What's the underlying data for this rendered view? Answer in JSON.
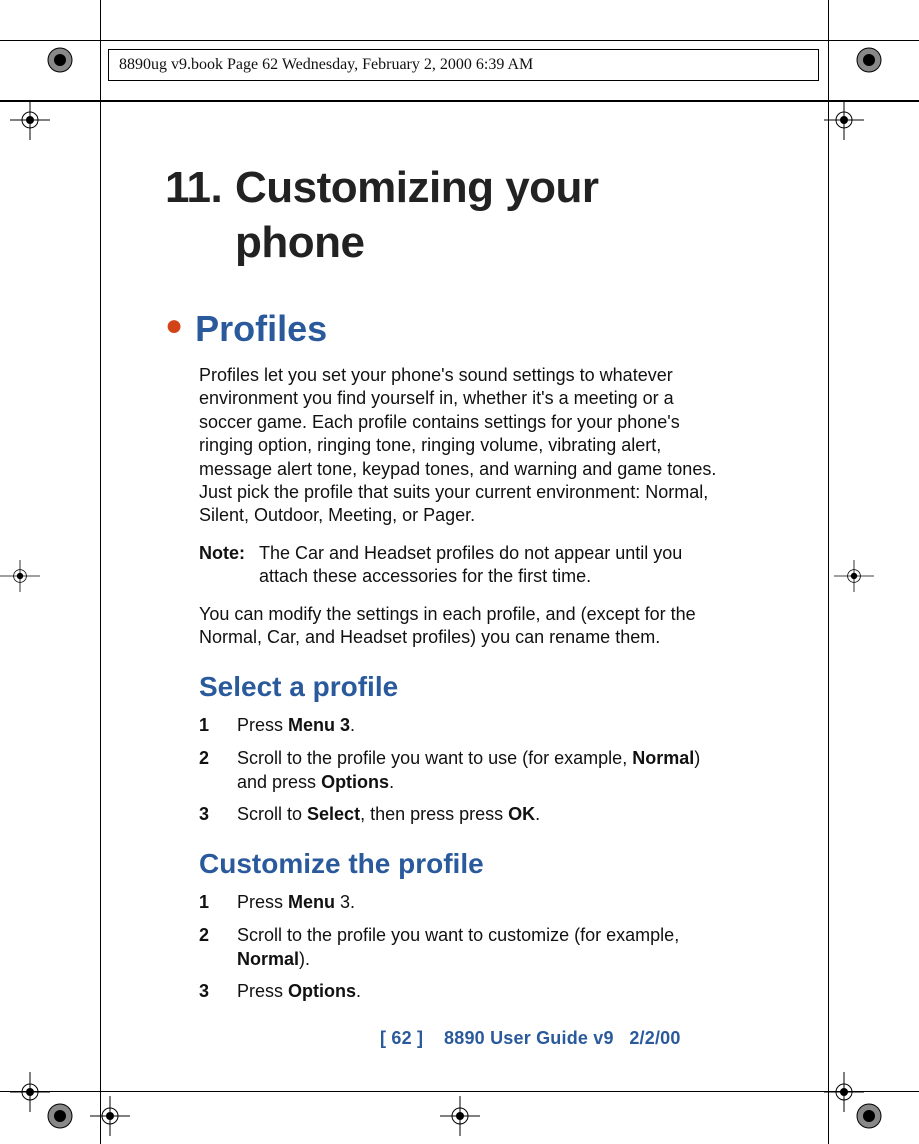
{
  "header": "8890ug v9.book  Page 62  Wednesday, February 2, 2000  6:39 AM",
  "chapter": {
    "num": "11.",
    "title_line1": "Customizing your",
    "title_line2": "phone"
  },
  "section": {
    "title": "Profiles"
  },
  "p1": "Profiles let you set your phone's sound settings to whatever environment you find yourself in, whether it's a meeting or a soccer game. Each profile contains settings for your phone's ringing option, ringing tone, ringing volume, vibrating alert, message alert tone, keypad tones, and warning and game tones. Just pick the profile that suits your current environment:  Normal, Silent, Outdoor, Meeting, or Pager.",
  "note": {
    "label": "Note:",
    "text": "The Car and Headset profiles do not appear until you attach these accessories for the first time."
  },
  "p2": "You can modify the settings in each profile, and (except for the Normal, Car, and Headset profiles) you can rename them.",
  "sub1": {
    "heading": "Select a profile"
  },
  "steps1": {
    "s1": {
      "n": "1",
      "pre": "Press ",
      "b1": "Menu 3",
      "post": "."
    },
    "s2": {
      "n": "2",
      "pre": "Scroll to the profile you want to use (for example, ",
      "b1": "Normal",
      "mid": ") and press ",
      "b2": "Options",
      "post": "."
    },
    "s3": {
      "n": "3",
      "pre": "Scroll to ",
      "b1": "Select",
      "mid": ", then press press ",
      "b2": "OK",
      "post": "."
    }
  },
  "sub2": {
    "heading": "Customize the profile"
  },
  "steps2": {
    "s1": {
      "n": "1",
      "pre": "Press ",
      "b1": "Menu",
      "post": " 3."
    },
    "s2": {
      "n": "2",
      "pre": "Scroll to the profile you want to customize (for example, ",
      "b1": "Normal",
      "post": ")."
    },
    "s3": {
      "n": "3",
      "pre": "Press ",
      "b1": "Options",
      "post": "."
    }
  },
  "footer": {
    "page": "[ 62 ]",
    "guide": "8890 User Guide v9",
    "date": "2/2/00"
  }
}
